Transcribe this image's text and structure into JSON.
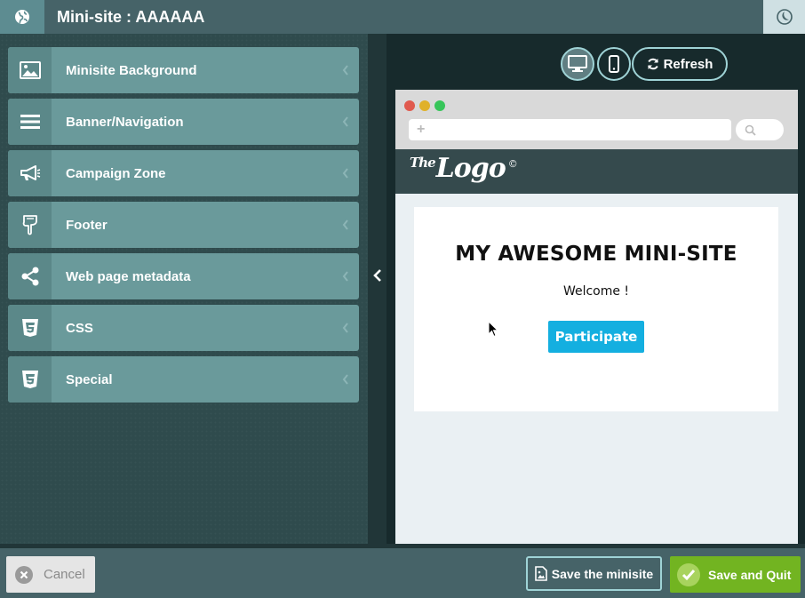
{
  "header": {
    "title": "Mini-site : AAAAAA",
    "left_icon": "globe-icon",
    "right_icon": "moon-icon"
  },
  "sidebar": {
    "items": [
      {
        "label": "Minisite Background",
        "icon": "image-icon"
      },
      {
        "label": "Banner/Navigation",
        "icon": "menu-bars-icon"
      },
      {
        "label": "Campaign Zone",
        "icon": "megaphone-icon"
      },
      {
        "label": "Footer",
        "icon": "hand-pointing-down-icon"
      },
      {
        "label": "Web page metadata",
        "icon": "share-icon"
      },
      {
        "label": "CSS",
        "icon": "css3-icon"
      },
      {
        "label": "Special",
        "icon": "css3-icon"
      }
    ]
  },
  "preview": {
    "refresh_label": "Refresh",
    "address_plus": "+",
    "site": {
      "logo_small": "The",
      "logo_main": "Logo",
      "logo_mark": "©",
      "heading": "MY AWESOME MINI-SITE",
      "welcome": "Welcome !",
      "participate_label": "Participate"
    }
  },
  "footer": {
    "cancel_label": "Cancel",
    "save_label": "Save the minisite",
    "save_quit_label": "Save and Quit"
  },
  "colors": {
    "header_bg": "#466368",
    "menu_item_bg": "#6a9a9b",
    "accent_border": "#9fd3d6",
    "participate_bg": "#14afe0",
    "save_quit_bg": "#72b421"
  }
}
